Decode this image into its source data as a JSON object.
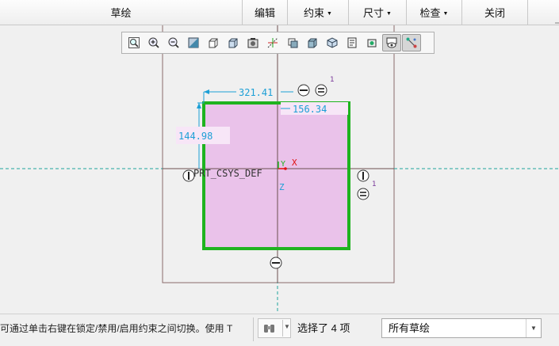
{
  "menu": {
    "sketch_label": "草绘",
    "edit_label": "编辑",
    "constrain_label": "约束",
    "dimension_label": "尺寸",
    "inspect_label": "检查",
    "close_label": "关闭"
  },
  "view_toolbar": {
    "icons": [
      "refit-icon",
      "zoom-in-icon",
      "zoom-out-icon",
      "repaint-icon",
      "saved-views-icon",
      "view-manager-icon",
      "display-style-icon",
      "datum-display-icon",
      "sketch-view-icon",
      "shading-icon",
      "perspective-icon",
      "annotation-display-icon",
      "spin-center-icon",
      "disp-filters-icon",
      "sketcher-display-icon"
    ],
    "active_icons": [
      "disp-filters-icon",
      "sketcher-display-icon"
    ]
  },
  "sketch": {
    "dim_width": "321.41",
    "dim_height": "144.98",
    "dim_offset": "156.34",
    "csys_label": "PRT_CSYS_DEF",
    "axis_y": "Y",
    "axis_x": "X",
    "axis_z": "Z",
    "constraint_vertical": "V",
    "constraint_horizontal": "H",
    "constraint_equal": "=",
    "constraint_flag": "1",
    "colors": {
      "selection": "#1fb31f",
      "fill": "#eac2ea",
      "dimension": "#1c9fd6",
      "centerline": "#1fa39b",
      "outline": "#8a6a6a"
    }
  },
  "status": {
    "message": "可通过单击右键在锁定/禁用/启用约束之间切换。使用 T",
    "selection_count": "选择了 4 项",
    "filter_value": "所有草绘"
  }
}
